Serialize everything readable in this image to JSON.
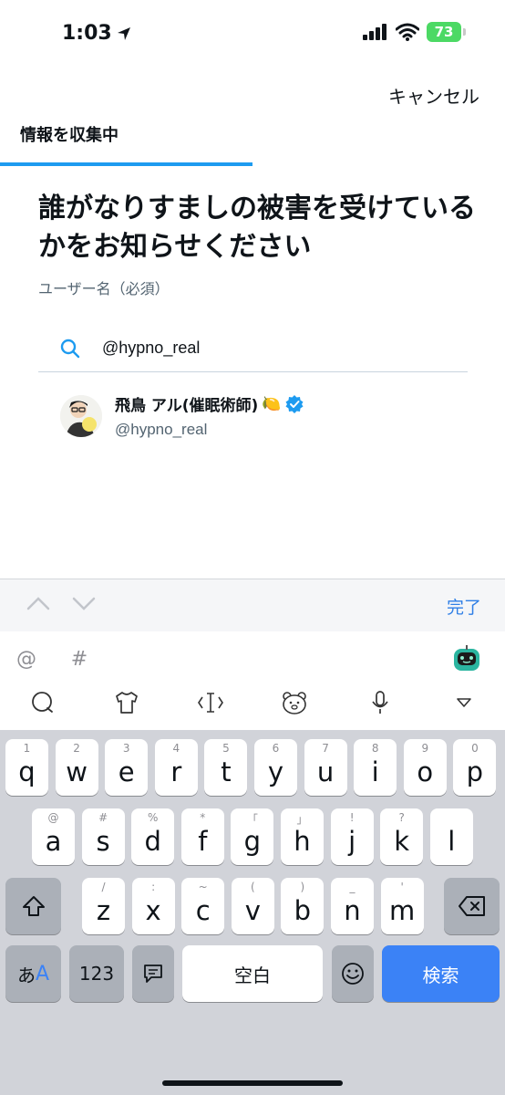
{
  "status_bar": {
    "time": "1:03",
    "battery": "73"
  },
  "header": {
    "cancel_label": "キャンセル",
    "step_label": "情報を収集中",
    "progress": 0.5
  },
  "main": {
    "heading": "誰がなりすましの被害を受けているかをお知らせください",
    "field_label": "ユーザー名（必須）",
    "search_value": "@hypno_real"
  },
  "result": {
    "name": "飛鳥 アル(催眠術師)",
    "emoji": "🍋",
    "handle": "@hypno_real",
    "verified": true
  },
  "accessory": {
    "done_label": "完了"
  },
  "ime": {
    "row1": [
      {
        "text": "@",
        "name": "at-key"
      },
      {
        "text": "#",
        "name": "hash-key"
      }
    ],
    "row2_icons": [
      "chat-icon",
      "shirt-icon",
      "cursor-icon",
      "bear-face-icon",
      "microphone-icon",
      "dropdown-triangle-icon"
    ]
  },
  "keyboard": {
    "row1": [
      {
        "k": "q",
        "h": "1"
      },
      {
        "k": "w",
        "h": "2"
      },
      {
        "k": "e",
        "h": "3"
      },
      {
        "k": "r",
        "h": "4"
      },
      {
        "k": "t",
        "h": "5"
      },
      {
        "k": "y",
        "h": "6"
      },
      {
        "k": "u",
        "h": "7"
      },
      {
        "k": "i",
        "h": "8"
      },
      {
        "k": "o",
        "h": "9"
      },
      {
        "k": "p",
        "h": "0"
      }
    ],
    "row2": [
      {
        "k": "a",
        "h": "@"
      },
      {
        "k": "s",
        "h": "#"
      },
      {
        "k": "d",
        "h": "%"
      },
      {
        "k": "f",
        "h": "*"
      },
      {
        "k": "g",
        "h": "「"
      },
      {
        "k": "h",
        "h": "」"
      },
      {
        "k": "j",
        "h": "!"
      },
      {
        "k": "k",
        "h": "?"
      },
      {
        "k": "l",
        "h": ""
      }
    ],
    "row3": [
      {
        "k": "z",
        "h": "/"
      },
      {
        "k": "x",
        "h": ":"
      },
      {
        "k": "c",
        "h": "~"
      },
      {
        "k": "v",
        "h": "("
      },
      {
        "k": "b",
        "h": ")"
      },
      {
        "k": "n",
        "h": "_"
      },
      {
        "k": "m",
        "h": "'"
      }
    ],
    "kana_label": "あ",
    "kana_label_2": "A",
    "num_label": "123",
    "space_label": "空白",
    "search_label": "検索"
  },
  "colors": {
    "accent": "#1d9bf0",
    "search_key": "#3b82f6",
    "done": "#2f7fe6"
  }
}
